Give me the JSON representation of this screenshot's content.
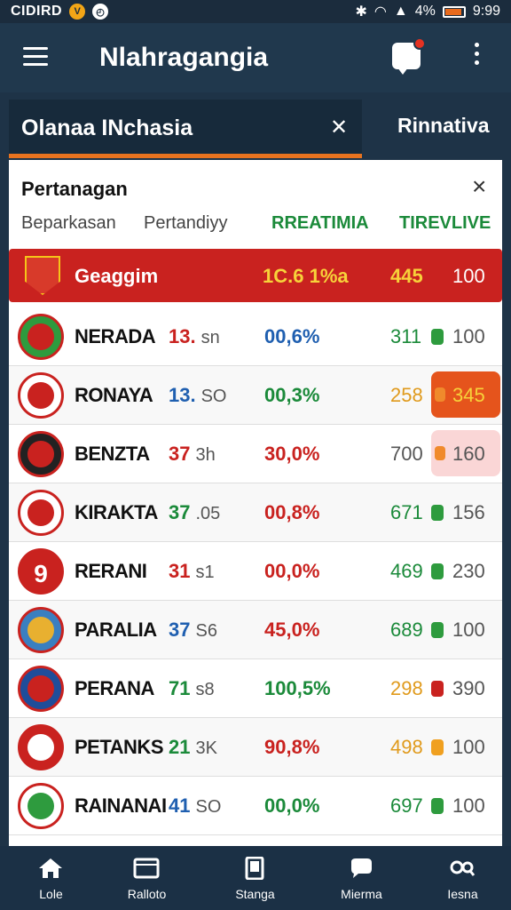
{
  "status_bar": {
    "carrier": "CIDIRD",
    "battery": "4%",
    "time": "9:99"
  },
  "app_bar": {
    "title": "Nlahragangia"
  },
  "tabs": {
    "active": "Olanaa INchasia",
    "other": "Rinnativa"
  },
  "card": {
    "title": "Pertanagan",
    "columns": [
      "Beparkasan",
      "Pertandiyy",
      "RREATIMIA",
      "TIREVLIVE"
    ],
    "highlight": {
      "name": "Geaggim",
      "pct": "1C.6 1%a",
      "value": "445",
      "max": "100"
    },
    "rows": [
      {
        "name": "NERADA",
        "num": "13.",
        "unit": "sn",
        "num_color": "#c9221f",
        "pct": "00,6%",
        "pct_color": "#1f5fb0",
        "value": "311",
        "value_color": "#1b8a3a",
        "mark_color": "#2e9b3e",
        "max": "100",
        "logo_bg": "#2e9b3e",
        "logo_inner": "#c9221f"
      },
      {
        "name": "RONAYA",
        "num": "13.",
        "unit": "SO",
        "num_color": "#1f5fb0",
        "pct": "00,3%",
        "pct_color": "#1b8a3a",
        "value": "258",
        "value_color": "#e09a1c",
        "pill_text": "345",
        "pill_bg": "#e5541c",
        "pill_text_color": "#f7d23a",
        "pill_mark_color": "#f08a2c",
        "logo_bg": "#fff",
        "logo_inner": "#c9221f"
      },
      {
        "name": "BENZTA",
        "num": "37",
        "unit": "3h",
        "num_color": "#c9221f",
        "pct": "30,0%",
        "pct_color": "#c9221f",
        "value": "700",
        "value_color": "#555",
        "pill_text": "160",
        "pill_bg": "#fad6d6",
        "pill_text_color": "#555",
        "pill_mark_color": "#f08a2c",
        "logo_bg": "#222",
        "logo_inner": "#c9221f"
      },
      {
        "name": "KIRAKTA",
        "num": "37",
        "unit": ".05",
        "num_color": "#1b8a3a",
        "pct": "00,8%",
        "pct_color": "#c9221f",
        "value": "671",
        "value_color": "#1b8a3a",
        "mark_color": "#2e9b3e",
        "max": "156",
        "logo_bg": "#fff",
        "logo_inner": "#c9221f"
      },
      {
        "name": "RERANI",
        "num": "31",
        "unit": "s1",
        "num_color": "#c9221f",
        "pct": "00,0%",
        "pct_color": "#c9221f",
        "value": "469",
        "value_color": "#1b8a3a",
        "mark_color": "#2e9b3e",
        "max": "230",
        "logo_bg": "#c9221f",
        "logo_num": "9"
      },
      {
        "name": "PARALIA",
        "num": "37",
        "unit": "S6",
        "num_color": "#1f5fb0",
        "pct": "45,0%",
        "pct_color": "#c9221f",
        "value": "689",
        "value_color": "#1b8a3a",
        "mark_color": "#2e9b3e",
        "max": "100",
        "logo_bg": "#3a7fc0",
        "logo_inner": "#e8b030"
      },
      {
        "name": "PERANA",
        "num": "71",
        "unit": "s8",
        "num_color": "#1b8a3a",
        "pct": "100,5%",
        "pct_color": "#1b8a3a",
        "value": "298",
        "value_color": "#e09a1c",
        "mark_color": "#c9221f",
        "max": "390",
        "logo_bg": "#1f4d9a",
        "logo_inner": "#c9221f"
      },
      {
        "name": "PETANKS",
        "num": "21",
        "unit": "3K",
        "num_color": "#1b8a3a",
        "pct": "90,8%",
        "pct_color": "#c9221f",
        "value": "498",
        "value_color": "#e09a1c",
        "mark_color": "#f0a020",
        "max": "100",
        "logo_bg": "#c9221f",
        "logo_inner": "#fff"
      },
      {
        "name": "RAINANAI",
        "num": "41",
        "unit": "SO",
        "num_color": "#1f5fb0",
        "pct": "00,0%",
        "pct_color": "#1b8a3a",
        "value": "697",
        "value_color": "#1b8a3a",
        "mark_color": "#2e9b3e",
        "max": "100",
        "logo_bg": "#fff",
        "logo_inner": "#2e9b3e"
      }
    ]
  },
  "bottom_nav": [
    {
      "label": "Lole",
      "icon": "home-icon"
    },
    {
      "label": "Ralloto",
      "icon": "window-icon"
    },
    {
      "label": "Stanga",
      "icon": "tablet-icon"
    },
    {
      "label": "Mierma",
      "icon": "chat-icon"
    },
    {
      "label": "Iesna",
      "icon": "search-icon"
    }
  ],
  "colors": {
    "accent": "#e8731f",
    "header_bg": "#20384d",
    "highlight_row": "#c9221f"
  }
}
